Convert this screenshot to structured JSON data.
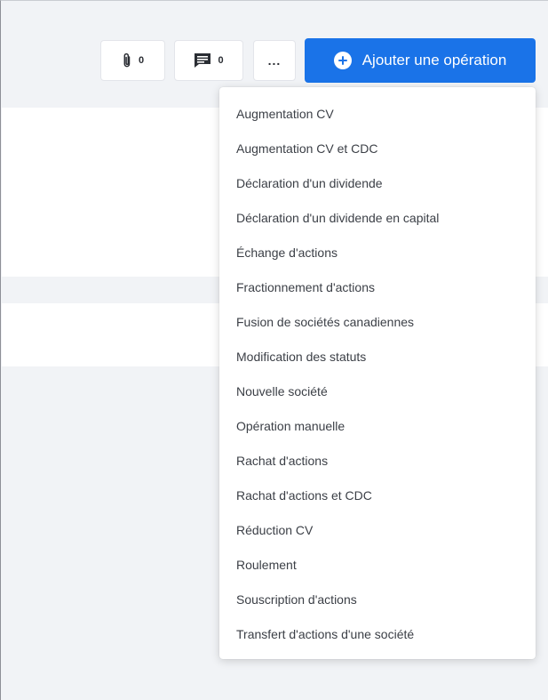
{
  "toolbar": {
    "attachments": {
      "icon": "paperclip-icon",
      "count": "0"
    },
    "comments": {
      "icon": "comment-icon",
      "count": "0"
    },
    "more": {
      "icon": "more-icon",
      "label": "..."
    },
    "primary_button": {
      "icon": "plus-circle-icon",
      "label": "Ajouter une opération"
    }
  },
  "menu": {
    "items": [
      "Augmentation CV",
      "Augmentation CV et CDC",
      "Déclaration d'un dividende",
      "Déclaration d'un dividende en capital",
      "Échange d'actions",
      "Fractionnement d'actions",
      "Fusion de sociétés canadiennes",
      "Modification des statuts",
      "Nouvelle société",
      "Opération manuelle",
      "Rachat d'actions",
      "Rachat d'actions et CDC",
      "Réduction CV",
      "Roulement",
      "Souscription d'actions",
      "Transfert d'actions d'une société"
    ]
  },
  "colors": {
    "accent": "#1a73e8",
    "background": "#f1f3f6",
    "text": "#3b3f46"
  }
}
